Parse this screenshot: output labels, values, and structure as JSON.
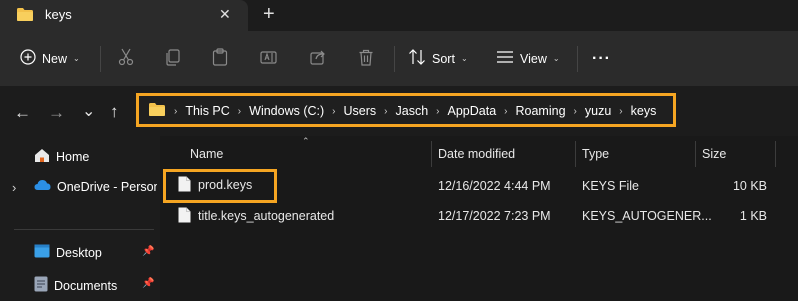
{
  "window": {
    "tab_title": "keys",
    "tab_close_glyph": "✕",
    "new_tab_glyph": "+"
  },
  "toolbar": {
    "new_label": "New",
    "sort_label": "Sort",
    "view_label": "View",
    "more_glyph": "···",
    "chevron": "⌄"
  },
  "navigation": {
    "back_glyph": "←",
    "forward_glyph": "→",
    "recent_glyph": "⌄",
    "up_glyph": "↑"
  },
  "address_bar": {
    "crumbs": [
      "This PC",
      "Windows (C:)",
      "Users",
      "Jasch",
      "AppData",
      "Roaming",
      "yuzu",
      "keys"
    ],
    "separator": "›"
  },
  "nav_pane": {
    "home_label": "Home",
    "onedrive_label": "OneDrive - Persona",
    "desktop_label": "Desktop",
    "documents_label": "Documents",
    "expand_glyph": "›",
    "pin_glyph": "📌"
  },
  "file_list": {
    "columns": {
      "name": "Name",
      "date": "Date modified",
      "type": "Type",
      "size": "Size"
    },
    "sort_glyph": "⌃",
    "rows": [
      {
        "name": "prod.keys",
        "date": "12/16/2022 4:44 PM",
        "type": "KEYS File",
        "size": "10 KB"
      },
      {
        "name": "title.keys_autogenerated",
        "date": "12/17/2022 7:23 PM",
        "type": "KEYS_AUTOGENER...",
        "size": "1 KB"
      }
    ]
  },
  "colors": {
    "highlight": "#f5a522",
    "folder": "#f3c14b",
    "background": "#1c1c1c",
    "toolbar": "#2b2b2b"
  }
}
